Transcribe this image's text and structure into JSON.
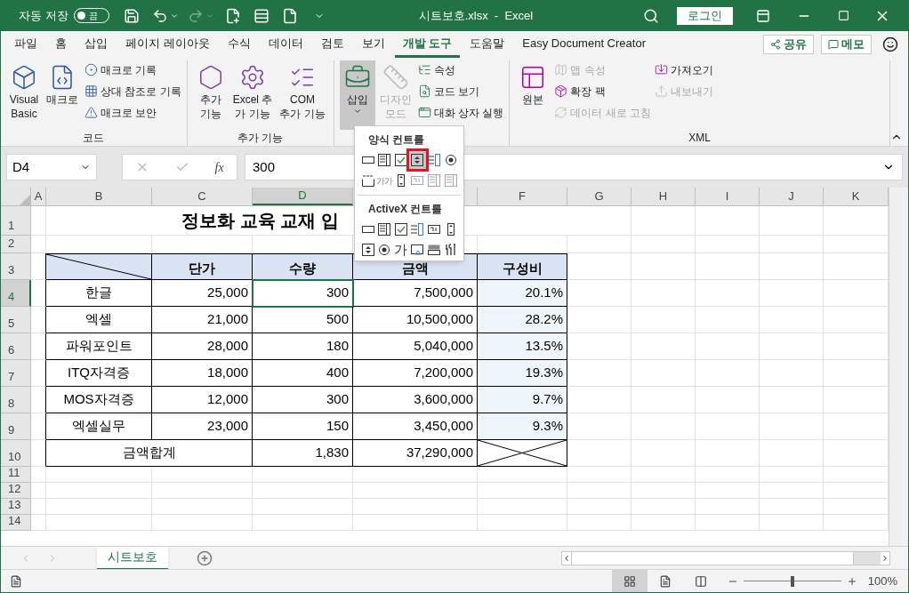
{
  "title_bar": {
    "autosave_label": "자동 저장",
    "autosave": {
      "on": false,
      "label": "끔"
    },
    "document_title": "시트보호.xlsx  -  Excel",
    "login_button": "로그인"
  },
  "menu_tabs": [
    {
      "label": "파일",
      "selected": false
    },
    {
      "label": "홈",
      "selected": false
    },
    {
      "label": "삽입",
      "selected": false
    },
    {
      "label": "페이지 레이아웃",
      "selected": false
    },
    {
      "label": "수식",
      "selected": false
    },
    {
      "label": "데이터",
      "selected": false
    },
    {
      "label": "검토",
      "selected": false
    },
    {
      "label": "보기",
      "selected": false
    },
    {
      "label": "개발 도구",
      "selected": true
    },
    {
      "label": "도움말",
      "selected": false
    },
    {
      "label": "Easy Document Creator",
      "selected": false
    }
  ],
  "share_button": "공유",
  "memo_button": "메모",
  "ribbon_groups": [
    {
      "label": "코드",
      "large_buttons": [
        {
          "label": "Visual\nBasic",
          "kind": "button",
          "expanded": false,
          "disabled": false
        },
        {
          "label": "매크로",
          "kind": "button",
          "expanded": false,
          "disabled": false
        }
      ],
      "columns": [
        [
          {
            "label": "매크로 기록",
            "disabled": false
          },
          {
            "label": "상대 참조로 기록",
            "disabled": false
          },
          {
            "label": "매크로 보안",
            "disabled": false
          }
        ]
      ]
    },
    {
      "label": "추가 기능",
      "large_buttons": [
        {
          "label": "추가\n기능",
          "kind": "button",
          "expanded": false,
          "disabled": false
        },
        {
          "label": "Excel 추\n가 기능",
          "kind": "button",
          "expanded": false,
          "disabled": false
        },
        {
          "label": "COM\n추가 기능",
          "kind": "button",
          "expanded": false,
          "disabled": false
        }
      ]
    },
    {
      "large_buttons": [
        {
          "label": "삽입",
          "kind": "menu",
          "expanded": true,
          "disabled": false
        },
        {
          "label": "디자인\n모드",
          "kind": "button",
          "expanded": false,
          "disabled": true
        }
      ],
      "columns": [
        [
          {
            "label": "속성",
            "disabled": false
          },
          {
            "label": "코드 보기",
            "disabled": false
          },
          {
            "label": "대화 상자 실행",
            "disabled": false
          }
        ]
      ]
    },
    {
      "label": "XML",
      "large_buttons": [
        {
          "label": "원본",
          "kind": "button",
          "expanded": false,
          "disabled": false
        }
      ],
      "columns": [
        [
          {
            "label": "맵 속성",
            "disabled": true
          },
          {
            "label": "확장 팩",
            "disabled": false
          },
          {
            "label": "데이터 새로 고침",
            "disabled": true
          }
        ],
        [
          {
            "label": "가져오기",
            "disabled": false
          },
          {
            "label": "내보내기",
            "disabled": true
          }
        ]
      ]
    }
  ],
  "name_box": "D4",
  "formula_fx": "fx",
  "formula_value": "300",
  "columns": [
    {
      "label": "A",
      "selected": false
    },
    {
      "label": "B",
      "selected": false
    },
    {
      "label": "C",
      "selected": false
    },
    {
      "label": "D",
      "selected": true
    },
    {
      "selected": false
    },
    {
      "label": "F",
      "selected": false
    },
    {
      "label": "G",
      "selected": false
    },
    {
      "label": "H",
      "selected": false
    },
    {
      "label": "I",
      "selected": false
    },
    {
      "label": "J",
      "selected": false
    },
    {
      "label": "K",
      "selected": false
    }
  ],
  "rows": [
    {
      "label": "1",
      "selected": false
    },
    {
      "label": "2",
      "selected": false
    },
    {
      "label": "3",
      "selected": false
    },
    {
      "label": "4",
      "selected": true
    },
    {
      "label": "5",
      "selected": false
    },
    {
      "label": "6",
      "selected": false
    },
    {
      "label": "7",
      "selected": false
    },
    {
      "label": "8",
      "selected": false
    },
    {
      "label": "9",
      "selected": false
    },
    {
      "label": "10",
      "selected": false
    },
    {
      "label": "11",
      "selected": false
    },
    {
      "label": "12",
      "selected": false
    },
    {
      "label": "13",
      "selected": false
    },
    {
      "label": "14",
      "selected": false
    }
  ],
  "report": {
    "title": "정보화 교육 교재 입",
    "header": [
      "단가",
      "수량",
      "금액",
      "구성비"
    ],
    "items": [
      {
        "cells": [
          "한글",
          "25,000",
          "300",
          "7,500,000",
          "20.1%"
        ]
      },
      {
        "cells": [
          "엑셀",
          "21,000",
          "500",
          "10,500,000",
          "28.2%"
        ]
      },
      {
        "cells": [
          "파워포인트",
          "28,000",
          "180",
          "5,040,000",
          "13.5%"
        ]
      },
      {
        "cells": [
          "ITQ자격증",
          "18,000",
          "400",
          "7,200,000",
          "19.3%"
        ]
      },
      {
        "cells": [
          "MOS자격증",
          "12,000",
          "300",
          "3,600,000",
          "9.7%"
        ]
      },
      {
        "cells": [
          "엑셀실무",
          "23,000",
          "150",
          "3,450,000",
          "9.3%"
        ]
      }
    ],
    "total": {
      "label": "금액합계",
      "cells": [
        "1,830",
        "37,290,000"
      ]
    }
  },
  "insert_menu": {
    "sections": [
      {
        "title": "양식 컨트롤",
        "controls": [
          {
            "kind": "button",
            "disabled": false,
            "selected": false
          },
          {
            "kind": "combobox",
            "disabled": false,
            "selected": false
          },
          {
            "kind": "checkbox",
            "disabled": false,
            "selected": false
          },
          {
            "kind": "spin",
            "disabled": false,
            "selected": true
          },
          {
            "kind": "listbox",
            "disabled": false,
            "selected": false
          },
          {
            "kind": "option",
            "disabled": false,
            "selected": false
          },
          {
            "kind": "groupbox",
            "disabled": false,
            "selected": false
          },
          {
            "kind": "label",
            "glyph": "가가",
            "disabled": false,
            "selected": false
          },
          {
            "kind": "scrollbar",
            "disabled": false,
            "selected": false
          },
          {
            "kind": "textfield",
            "disabled": true,
            "selected": false
          },
          {
            "kind": "combolist",
            "disabled": true,
            "selected": false
          },
          {
            "kind": "combodrop",
            "disabled": true,
            "selected": false
          }
        ]
      },
      {
        "title": "ActiveX 컨트롤",
        "controls": [
          {
            "kind": "button",
            "disabled": false,
            "selected": false
          },
          {
            "kind": "combobox",
            "disabled": false,
            "selected": false
          },
          {
            "kind": "checkbox",
            "disabled": false,
            "selected": false
          },
          {
            "kind": "listbox",
            "disabled": false,
            "selected": false
          },
          {
            "kind": "textfield",
            "disabled": false,
            "selected": false
          },
          {
            "kind": "scrollbar",
            "disabled": false,
            "selected": false
          },
          {
            "kind": "spin",
            "disabled": false,
            "selected": false
          },
          {
            "kind": "option",
            "disabled": false,
            "selected": false
          },
          {
            "kind": "label",
            "glyph": "가",
            "disabled": false,
            "selected": false
          },
          {
            "kind": "image",
            "disabled": false,
            "selected": false
          },
          {
            "kind": "toggle",
            "disabled": false,
            "selected": false
          },
          {
            "kind": "more",
            "disabled": false,
            "selected": false
          }
        ]
      }
    ]
  },
  "sheet_tabs": [
    {
      "label": "시트보호",
      "selected": true
    }
  ],
  "status_bar": {
    "views": [
      {
        "kind": "normal",
        "selected": true
      },
      {
        "kind": "page_layout",
        "selected": false
      },
      {
        "kind": "page_break",
        "selected": false
      }
    ],
    "zoom": {
      "level": 0.5,
      "label": "100%"
    }
  }
}
